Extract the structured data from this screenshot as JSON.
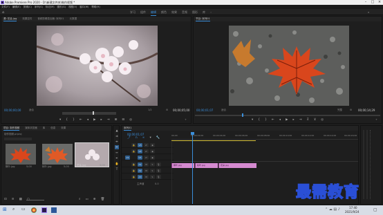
{
  "title_bar": {
    "text": "Adobe Premiere Pro 2020 - D:\\新建文件夹\\制作视频 *"
  },
  "menu": [
    "文件(F)",
    "编辑(E)",
    "剪辑(C)",
    "序列(S)",
    "标记(M)",
    "图形(G)",
    "视图(V)",
    "窗口(W)",
    "帮助(H)"
  ],
  "workspaces": [
    "学习",
    "组件",
    "编辑",
    "颜色",
    "效果",
    "音频",
    "图形",
    "库"
  ],
  "source_panel": {
    "tabs": [
      "源: 花朵.jpg",
      "效果控件",
      "音频剪辑混合器: 序列01",
      "元数据"
    ],
    "timecode": "00;00;00;00",
    "fit": "适合",
    "zoom_value": "1/2",
    "duration": "00;00;05;00"
  },
  "program_panel": {
    "tabs": [
      "节目: 序列01"
    ],
    "timecode": "00;00;01;07",
    "fit": "适合",
    "zoom_value": "完整",
    "duration": "00;00;14;29"
  },
  "project_panel": {
    "tabs": [
      "项目: 制作视频",
      "媒体浏览器",
      "库",
      "信息",
      "效果"
    ],
    "project_file": "制作视频.prproj",
    "items": [
      {
        "name": "枫叶.jpg",
        "duration": "5;00"
      },
      {
        "name": "秋叶.jpg",
        "duration": "5;00"
      },
      {
        "name": "花朵.jpg",
        "duration": "5;00"
      }
    ]
  },
  "timeline_panel": {
    "tab": "序列01",
    "timecode": "00;00;01;07",
    "ruler": [
      "00;00",
      "00;00;02;00",
      "00;00;04;00",
      "00;00;06;00",
      "00;00;08;00",
      "00;00;10;00",
      "00;00;12;00",
      "00;00;14;00",
      "00;00;16;00"
    ],
    "video_tracks": [
      "V3",
      "V2",
      "V1"
    ],
    "audio_tracks": [
      "A1",
      "A2",
      "A3"
    ],
    "master_label": "主声道",
    "master_value": "0.0",
    "clips": [
      {
        "name": "枫叶.jpg"
      },
      {
        "name": "秋叶.jpg"
      },
      {
        "name": "花朵.jpg"
      }
    ]
  },
  "watermark": "最需教育",
  "taskbar": {
    "time": "17:40",
    "date": "2021/9/24"
  },
  "colors": {
    "accent": "#3b8fdb",
    "clip": "#d58ad0",
    "panel": "#1e1e1e"
  }
}
